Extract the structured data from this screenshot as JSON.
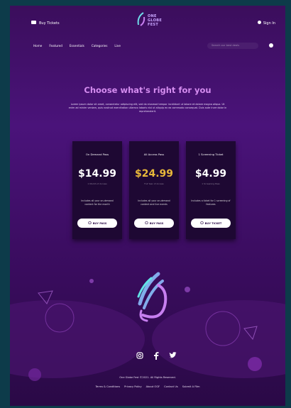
{
  "header": {
    "buy_tickets": "Buy Tickets",
    "logo_lines": [
      "ONE",
      "GLOBE",
      "FEST"
    ],
    "sign_in": "Sign In"
  },
  "nav": {
    "items": [
      "Home",
      "Featured",
      "Essentials",
      "Categories",
      "Live"
    ],
    "search_placeholder": "Search our best deals"
  },
  "hero": {
    "title": "Choose what's right for you",
    "subtitle": "Lorem ipsum dolor sit amet, consectetur adipiscing elit, sed do eiusmod tempor incididunt ut labore et dolore magna aliqua. Ut enim ad minim veniam, quis nostrud exercitation ullamco laboris nisi ut aliquip ex ea commodo consequat. Duis aute irure dolor in reprehenderit."
  },
  "plans": [
    {
      "title": "On Demand Pass",
      "price": "$14.99",
      "price_color": "#ffffff",
      "note": "1 Month of Access",
      "desc": "Includes all your on-demand content for the month",
      "button": "BUY PASS"
    },
    {
      "title": "All Access Pass",
      "price": "$24.99",
      "price_color": "#e8b83a",
      "note": "Full Year of Access",
      "desc": "Includes all your on-demand content and live events",
      "button": "BUY PASS"
    },
    {
      "title": "1 Screening Ticket",
      "price": "$4.99",
      "price_color": "#ffffff",
      "note": "1 Screening Pass",
      "desc": "Includes a ticket for 1 screening of features",
      "button": "BUY TICKET"
    }
  ],
  "footer": {
    "social": [
      "instagram-icon",
      "facebook-icon",
      "twitter-icon"
    ],
    "copyright": "One Globe Fest ©2021. All Rights Reserved.",
    "links": [
      "Terms & Conditions",
      "Privacy Policy",
      "About OGF",
      "Contact Us",
      "Submit A Film"
    ]
  },
  "colors": {
    "background": "#3b0e5c",
    "accent_title": "#d58df0",
    "card": "#1e0833",
    "gold": "#e8b83a"
  }
}
